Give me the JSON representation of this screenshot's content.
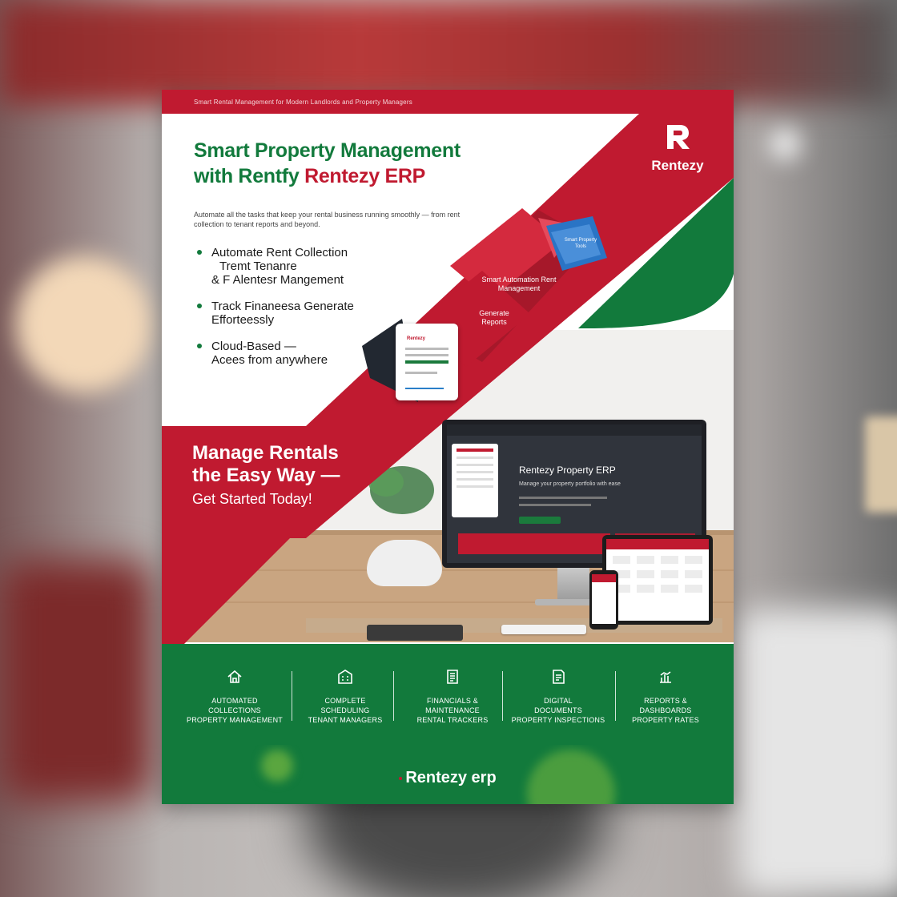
{
  "flyer": {
    "top_tagline": "Smart Rental Management for Modern Landlords and Property Managers",
    "logo_text": "Rentezy",
    "headline_line1": "Smart Property Management",
    "headline_line2_prefix": "with Rentfy ",
    "headline_line2_brand": "Rentezy ERP",
    "intro": "Automate all the tasks that keep your rental business running smoothly — from rent collection to tenant reports and beyond.",
    "features": [
      {
        "lines": [
          "Automate Rent Collection",
          "Tremt Tenanre",
          "& F  Alentesr Mangement"
        ]
      },
      {
        "lines": [
          "Track Finaneesa Generate",
          "Efforteessly"
        ]
      },
      {
        "lines": [
          "Cloud-Based —",
          "Acees from anywhere"
        ]
      }
    ],
    "cta": {
      "line1": "Manage Rentals",
      "line2": "the Easy Way —",
      "line3": "Get Started Today!"
    },
    "cards": {
      "phone_title": "Rentezy",
      "red_card_text": "Smart Automation Rent Management",
      "red_card_small": "Generate Reports",
      "blue_card_text": "Smart Property Tools"
    },
    "monitor": {
      "title": "Rentezy Property ERP",
      "subtitle": "Manage your property portfolio with ease"
    },
    "strip_items": [
      {
        "icon": "home-icon",
        "lines": [
          "AUTOMATED",
          "COLLECTIONS",
          "PROPERTY MANAGEMENT"
        ]
      },
      {
        "icon": "building-icon",
        "lines": [
          "COMPLETE",
          "SCHEDULING",
          "TENANT MANAGERS"
        ]
      },
      {
        "icon": "document-icon",
        "lines": [
          "FINANCIALS &",
          "MAINTENANCE",
          "RENTAL TRACKERS"
        ]
      },
      {
        "icon": "invoice-icon",
        "lines": [
          "DIGITAL",
          "DOCUMENTS",
          "PROPERTY INSPECTIONS"
        ]
      },
      {
        "icon": "analytics-icon",
        "lines": [
          "REPORTS &",
          "DASHBOARDS",
          "PROPERTY RATES"
        ]
      }
    ],
    "footer_brand": "Rentezy erp"
  },
  "colors": {
    "brand_red": "#c01a30",
    "brand_green": "#127a3c",
    "white": "#ffffff"
  }
}
